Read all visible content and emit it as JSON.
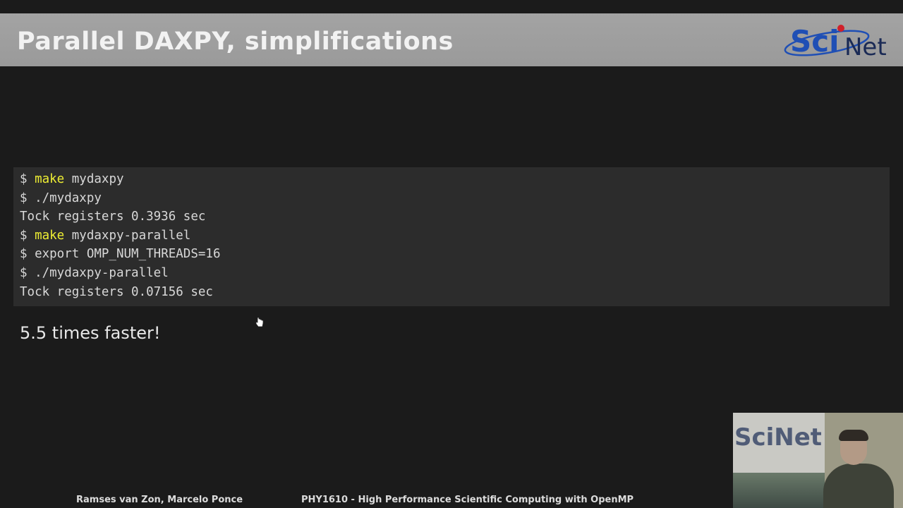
{
  "slide": {
    "title": "Parallel DAXPY, simplifications",
    "logo_text": {
      "part1": "Sci",
      "part2": "Net"
    },
    "code_lines": [
      {
        "prompt": "$ ",
        "keyword": "make",
        "rest": " mydaxpy"
      },
      {
        "prompt": "$ ",
        "keyword": "",
        "rest": "./mydaxpy"
      },
      {
        "prompt": "",
        "keyword": "",
        "rest": "Tock registers 0.3936 sec"
      },
      {
        "prompt": "$ ",
        "keyword": "make",
        "rest": " mydaxpy-parallel"
      },
      {
        "prompt": "$ ",
        "keyword": "",
        "rest": "export OMP_NUM_THREADS=16"
      },
      {
        "prompt": "$ ",
        "keyword": "",
        "rest": "./mydaxpy-parallel"
      },
      {
        "prompt": "",
        "keyword": "",
        "rest": "Tock registers 0.07156 sec"
      }
    ],
    "note": "5.5 times faster!"
  },
  "footer": {
    "authors": "Ramses van Zon, Marcelo Ponce",
    "course": "PHY1610 - High Performance Scientific Computing with OpenMP"
  },
  "webcam": {
    "banner_text": "SciNet"
  },
  "colors": {
    "background": "#1b1b1b",
    "title_bar": "#9d9d9d",
    "code_bg": "#2c2c2c",
    "keyword": "#eeee33",
    "logo_blue": "#1f4fb5",
    "logo_red": "#d0202a"
  }
}
